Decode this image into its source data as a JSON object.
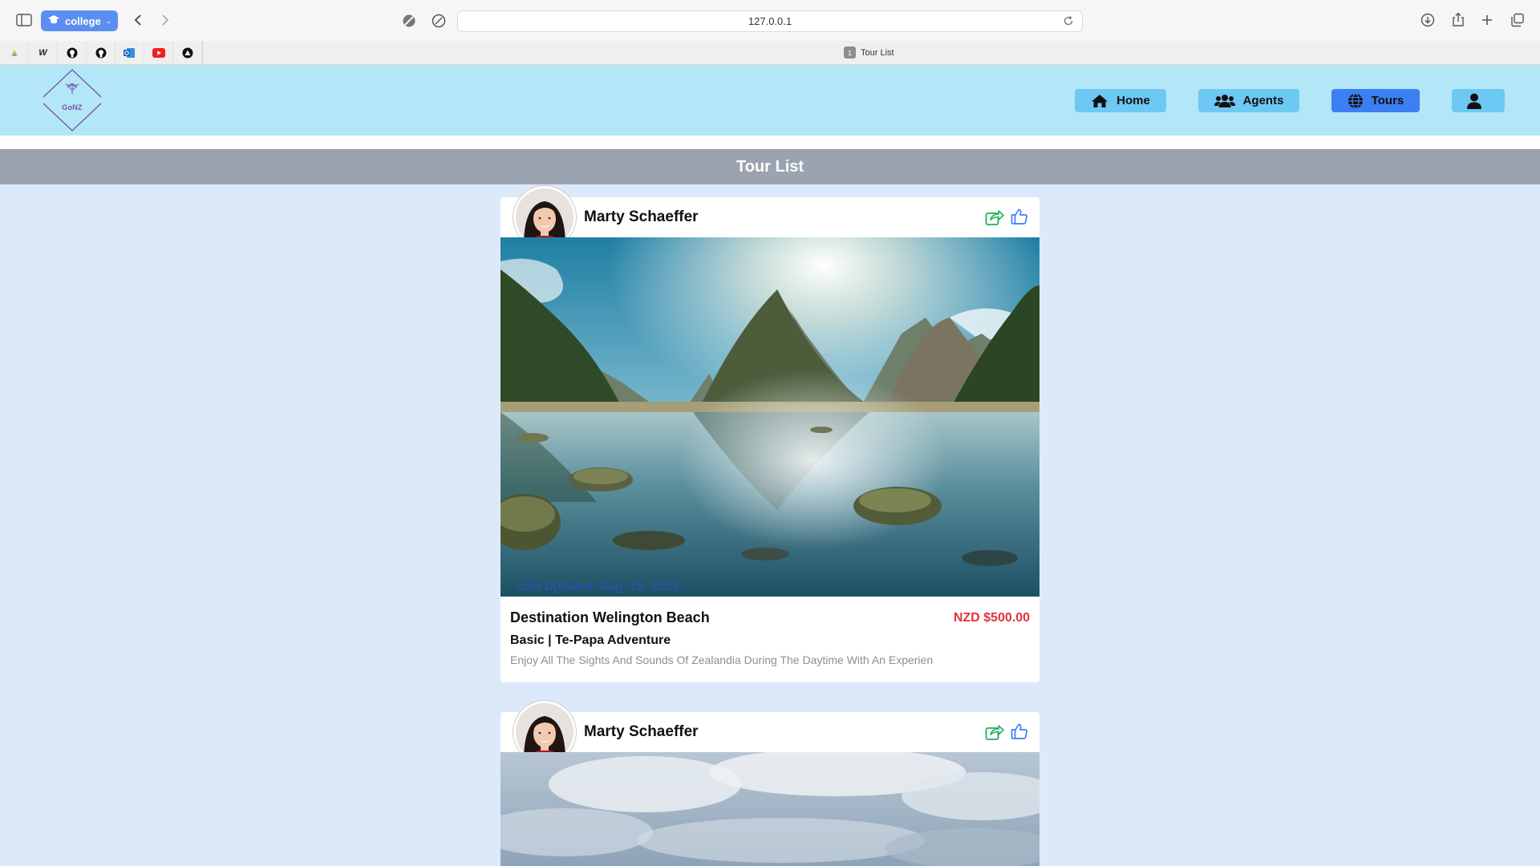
{
  "browser": {
    "profile_label": "college",
    "url": "127.0.0.1",
    "tab_number": "1",
    "tab_title": "Tour List"
  },
  "site": {
    "logo_text": "GoNZ",
    "nav": [
      {
        "label": "Home",
        "icon": "home-icon"
      },
      {
        "label": "Agents",
        "icon": "users-icon"
      },
      {
        "label": "Tours",
        "icon": "globe-icon",
        "active": true
      },
      {
        "label": "",
        "icon": "user-icon"
      }
    ],
    "page_title": "Tour List"
  },
  "tours": [
    {
      "agent_name": "Marty Schaeffer",
      "last_updated": "Last Updated: Aug. 18, 2023",
      "destination": "Destination Welington Beach",
      "price": "NZD $500.00",
      "package": "Basic | Te-Papa Adventure",
      "description": "Enjoy All The Sights And Sounds Of Zealandia During The Daytime With An Experien"
    },
    {
      "agent_name": "Marty Schaeffer"
    }
  ],
  "colors": {
    "header_bg": "#b3e6f7",
    "nav_button": "#6ec8f4",
    "nav_active": "#3b7ff2",
    "title_bar": "#9ba3b0",
    "page_bg": "#dce9fb",
    "price": "#e2323b",
    "share_icon": "#1fae5c",
    "like_icon": "#3b7ff2"
  }
}
